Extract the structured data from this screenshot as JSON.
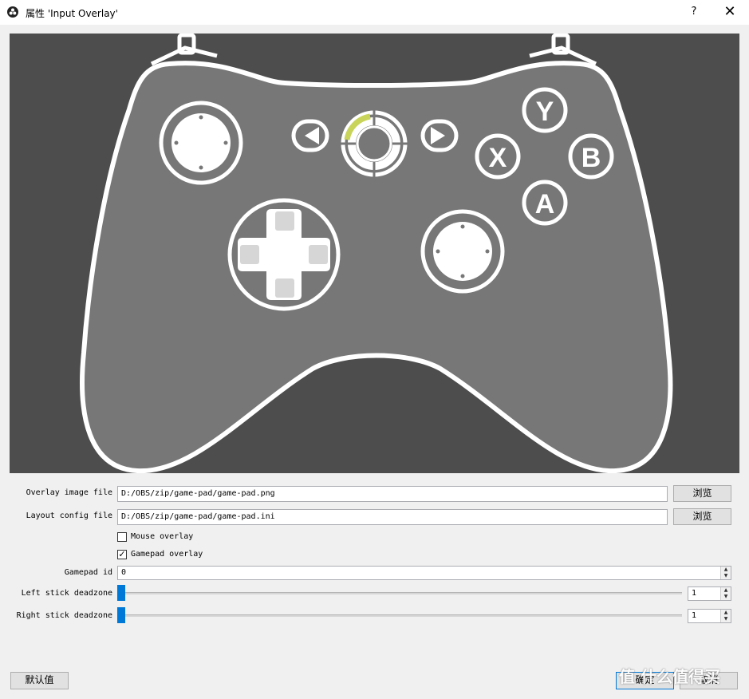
{
  "window": {
    "title": "属性 'Input Overlay'",
    "help_glyph": "?",
    "close_glyph": "✕"
  },
  "gamepad": {
    "buttons": {
      "y": "Y",
      "x": "X",
      "b": "B",
      "a": "A"
    },
    "guide_highlight_color": "#c9d45a",
    "background_color": "#4d4d4d",
    "body_color": "#777777"
  },
  "form": {
    "overlay_image": {
      "label": "Overlay image file",
      "value": "D:/OBS/zip/game-pad/game-pad.png",
      "browse": "浏览"
    },
    "layout_config": {
      "label": "Layout config file",
      "value": "D:/OBS/zip/game-pad/game-pad.ini",
      "browse": "浏览"
    },
    "mouse_overlay": {
      "label": "Mouse overlay",
      "checked": false
    },
    "gamepad_overlay": {
      "label": "Gamepad overlay",
      "checked": true,
      "mark": "✓"
    },
    "gamepad_id": {
      "label": "Gamepad id",
      "value": "0"
    },
    "left_deadzone": {
      "label": "Left stick deadzone",
      "value": "1"
    },
    "right_deadzone": {
      "label": "Right stick deadzone",
      "value": "1"
    }
  },
  "footer": {
    "defaults": "默认值",
    "ok": "确定",
    "cancel": "取消"
  },
  "watermark": "值 什么值得买"
}
